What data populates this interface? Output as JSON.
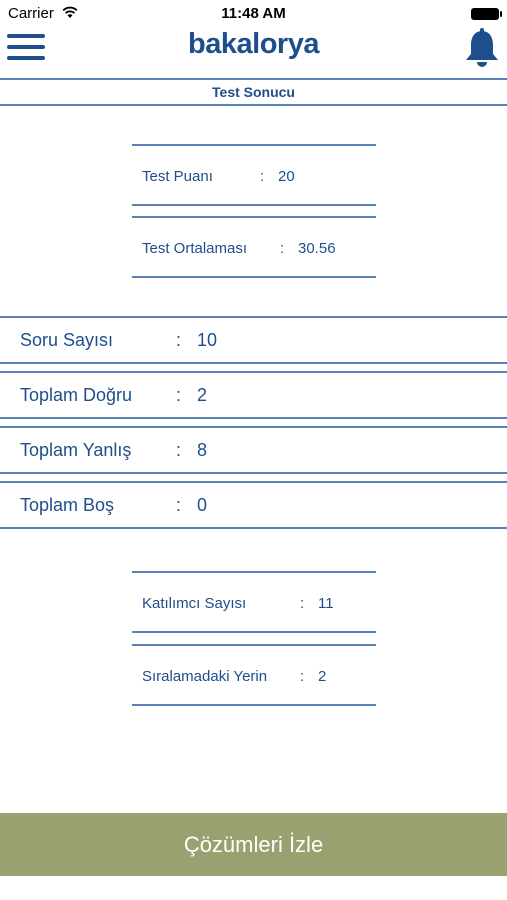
{
  "status_bar": {
    "carrier": "Carrier",
    "time": "11:48 AM"
  },
  "nav": {
    "logo": "bakalorya"
  },
  "title": "Test Sonucu",
  "score_card": [
    {
      "label": "Test Puanı",
      "value": "20"
    },
    {
      "label": "Test Ortalaması",
      "value": "30.56"
    }
  ],
  "stats": [
    {
      "label": "Soru Sayısı",
      "value": "10"
    },
    {
      "label": "Toplam Doğru",
      "value": "2"
    },
    {
      "label": "Toplam Yanlış",
      "value": "8"
    },
    {
      "label": "Toplam Boş",
      "value": "0"
    }
  ],
  "rank_card": [
    {
      "label": "Katılımcı Sayısı",
      "value": "11"
    },
    {
      "label": "Sıralamadaki Yerin",
      "value": "2"
    }
  ],
  "separator": ":",
  "solutions_button": "Çözümleri İzle",
  "colors": {
    "primary": "#1f4e8c",
    "line": "#5b83b8",
    "button": "#9ba070"
  }
}
